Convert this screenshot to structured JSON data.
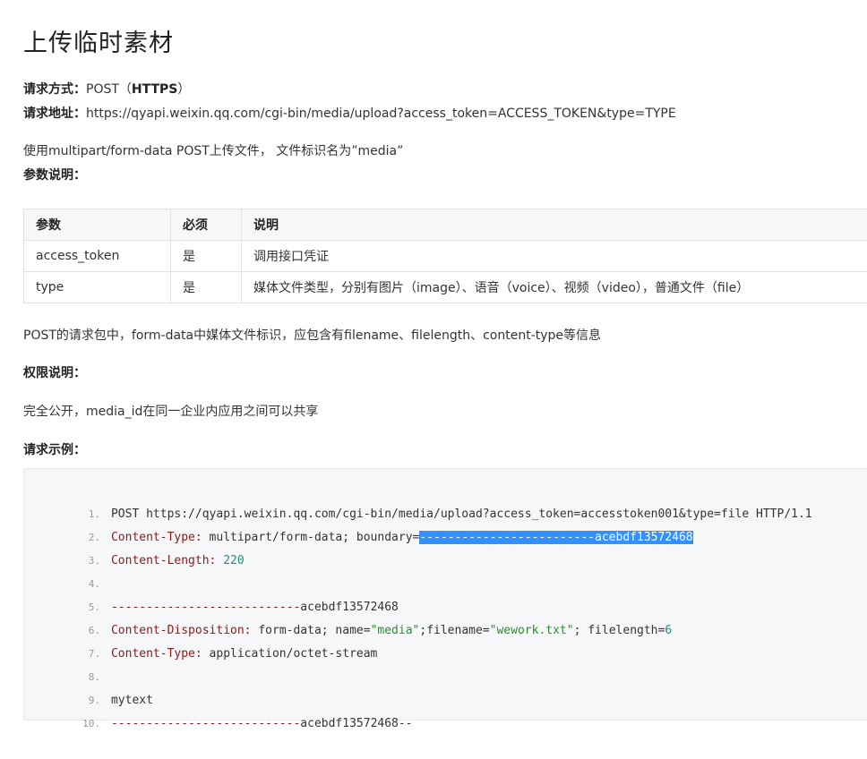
{
  "title": "上传临时素材",
  "request": {
    "method_label": "请求方式：",
    "method_value_pre": "POST（",
    "method_value_bold": "HTTPS",
    "method_value_post": "）",
    "address_label": "请求地址：",
    "address_value": "https://qyapi.weixin.qq.com/cgi-bin/media/upload?access_token=ACCESS_TOKEN&type=TYPE"
  },
  "intro": "使用multipart/form-data POST上传文件， 文件标识名为”media”",
  "params_heading": "参数说明：",
  "params_table": {
    "headers": [
      "参数",
      "必须",
      "说明"
    ],
    "rows": [
      [
        "access_token",
        "是",
        "调用接口凭证"
      ],
      [
        "type",
        "是",
        "媒体文件类型，分别有图片（image）、语音（voice）、视频（video），普通文件（file）"
      ]
    ]
  },
  "post_note": "POST的请求包中，form-data中媒体文件标识，应包含有filename、filelength、content-type等信息",
  "permission_heading": "权限说明：",
  "permission_text": "完全公开，media_id在同一企业内应用之间可以共享",
  "example_heading": "请求示例：",
  "code": {
    "l1": "POST https://qyapi.weixin.qq.com/cgi-bin/media/upload?access_token=accesstoken001&type=file HTTP/1.1",
    "l2_key": "Content-Type:",
    "l2_val": " multipart/form-data; boundary=",
    "l2_sel": "-------------------------acebdf13572468",
    "l3_key": "Content-Length:",
    "l3_num": " 220",
    "l5_dash": "---------------------------",
    "l5_id": "acebdf13572468",
    "l6_key": "Content-Disposition:",
    "l6_a": " form-data; name=",
    "l6_s1": "\"media\"",
    "l6_b": ";filename=",
    "l6_s2": "\"wework.txt\"",
    "l6_c": "; filelength=",
    "l6_num": "6",
    "l7_key": "Content-Type:",
    "l7_val": " application/octet-stream",
    "l9": "mytext",
    "l10_dash": "---------------------------",
    "l10_id": "acebdf13572468--",
    "line_numbers": [
      "1.",
      "2.",
      "3.",
      "4.",
      "5.",
      "6.",
      "7.",
      "8.",
      "9.",
      "10."
    ]
  }
}
